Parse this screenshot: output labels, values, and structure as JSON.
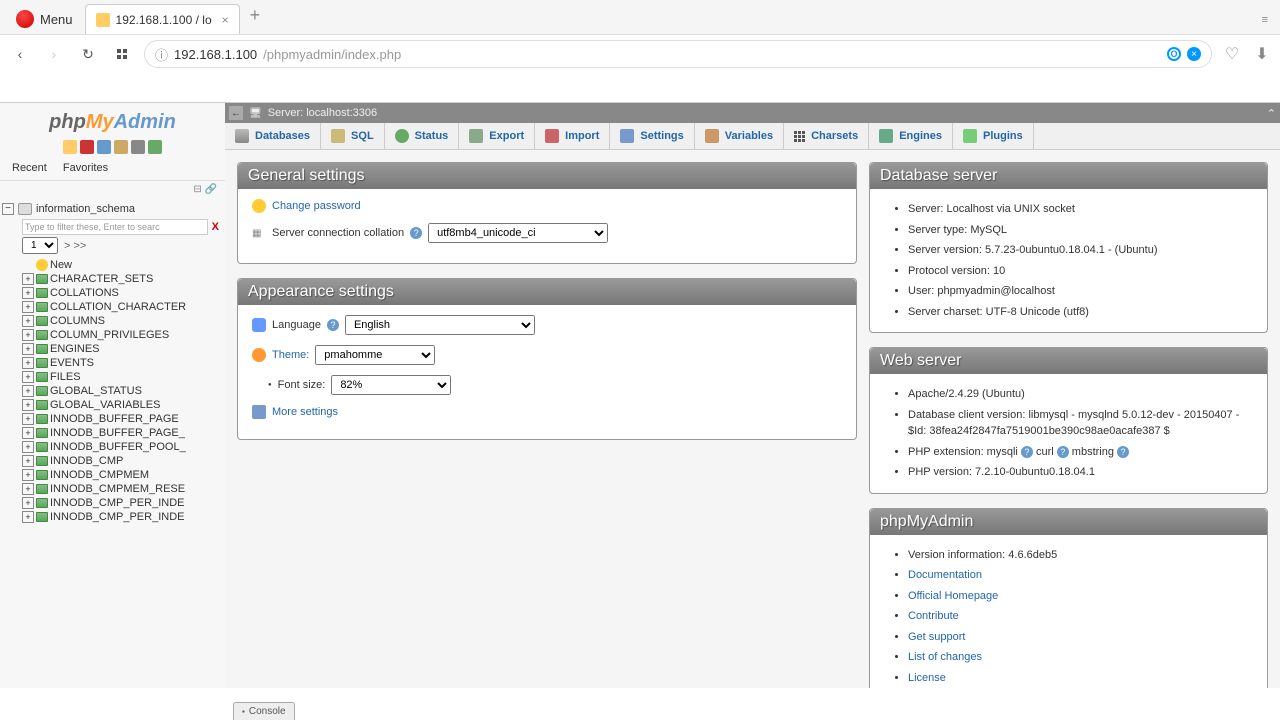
{
  "browser": {
    "menu_label": "Menu",
    "tab_title": "192.168.1.100 / lo",
    "url_host": "192.168.1.100",
    "url_path": "/phpmyadmin/index.php"
  },
  "logo": {
    "php": "php",
    "my": "My",
    "admin": "Admin"
  },
  "nav_tabs": {
    "recent": "Recent",
    "favorites": "Favorites"
  },
  "db_tree": {
    "database": "information_schema",
    "filter_placeholder": "Type to filter these, Enter to searc",
    "page": "1",
    "pager_next": "> >>",
    "new_label": "New",
    "tables": [
      "CHARACTER_SETS",
      "COLLATIONS",
      "COLLATION_CHARACTER",
      "COLUMNS",
      "COLUMN_PRIVILEGES",
      "ENGINES",
      "EVENTS",
      "FILES",
      "GLOBAL_STATUS",
      "GLOBAL_VARIABLES",
      "INNODB_BUFFER_PAGE",
      "INNODB_BUFFER_PAGE_",
      "INNODB_BUFFER_POOL_",
      "INNODB_CMP",
      "INNODB_CMPMEM",
      "INNODB_CMPMEM_RESE",
      "INNODB_CMP_PER_INDE",
      "INNODB_CMP_PER_INDE"
    ]
  },
  "serverbar": {
    "label": "Server: localhost:3306"
  },
  "toptabs": {
    "databases": "Databases",
    "sql": "SQL",
    "status": "Status",
    "export": "Export",
    "import": "Import",
    "settings": "Settings",
    "variables": "Variables",
    "charsets": "Charsets",
    "engines": "Engines",
    "plugins": "Plugins"
  },
  "panels": {
    "general": {
      "title": "General settings",
      "change_password": "Change password",
      "collation_label": "Server connection collation",
      "collation_value": "utf8mb4_unicode_ci"
    },
    "appearance": {
      "title": "Appearance settings",
      "language_label": "Language",
      "language_value": "English",
      "theme_label": "Theme:",
      "theme_value": "pmahomme",
      "fontsize_label": "Font size:",
      "fontsize_value": "82%",
      "more": "More settings"
    },
    "dbserver": {
      "title": "Database server",
      "items": [
        "Server: Localhost via UNIX socket",
        "Server type: MySQL",
        "Server version: 5.7.23-0ubuntu0.18.04.1 - (Ubuntu)",
        "Protocol version: 10",
        "User: phpmyadmin@localhost",
        "Server charset: UTF-8 Unicode (utf8)"
      ]
    },
    "webserver": {
      "title": "Web server",
      "items": [
        "Apache/2.4.29 (Ubuntu)",
        "Database client version: libmysql - mysqlnd 5.0.12-dev - 20150407 - $Id: 38fea24f2847fa7519001be390c98ae0acafe387 $",
        "PHP extension: mysqli curl mbstring",
        "PHP version: 7.2.10-0ubuntu0.18.04.1"
      ]
    },
    "pma": {
      "title": "phpMyAdmin",
      "version": "Version information: 4.6.6deb5",
      "links": [
        "Documentation",
        "Official Homepage",
        "Contribute",
        "Get support",
        "List of changes",
        "License"
      ]
    }
  },
  "console": "Console"
}
